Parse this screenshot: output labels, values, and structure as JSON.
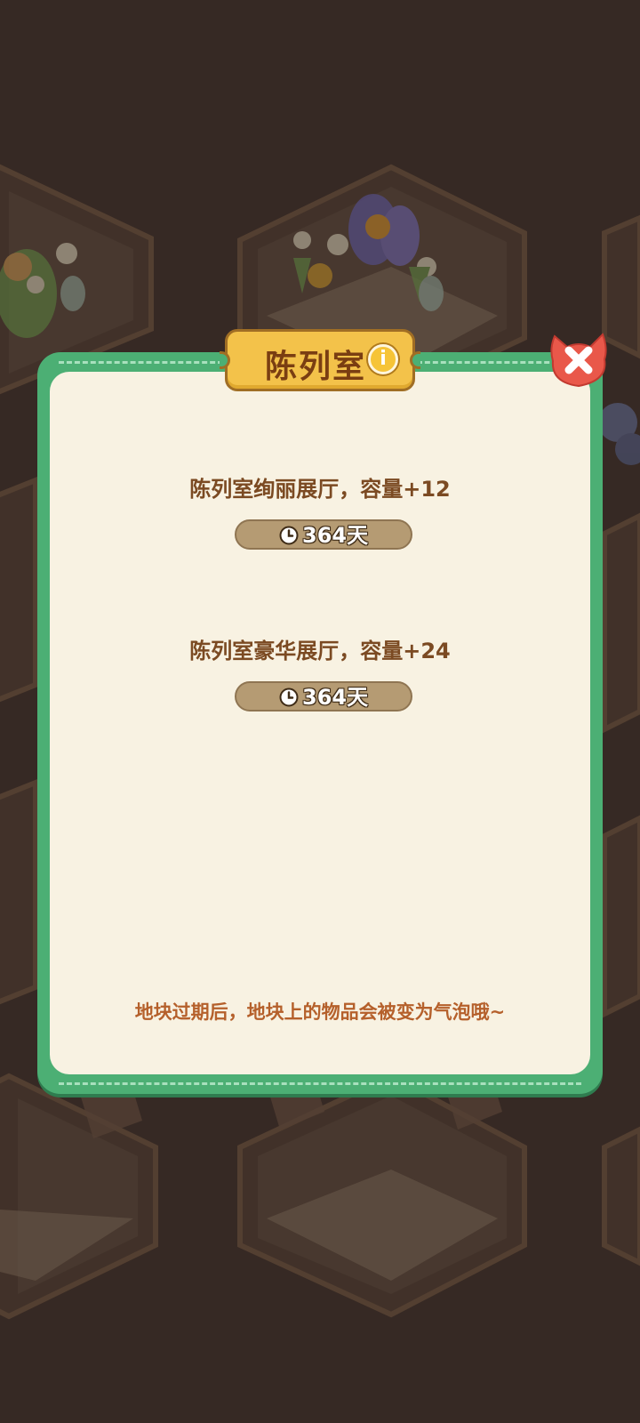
{
  "dialog": {
    "title": "陈列室",
    "info_icon": "info-icon",
    "close_icon": "close-icon",
    "items": [
      {
        "label": "陈列室绚丽展厅，容量+12",
        "duration": "364天",
        "icon": "clock-icon"
      },
      {
        "label": "陈列室豪华展厅，容量+24",
        "duration": "364天",
        "icon": "clock-icon"
      }
    ],
    "footer_note": "地块过期后，地块上的物品会被变为气泡哦~"
  },
  "colors": {
    "dialog_border": "#4caf74",
    "dialog_fill": "#f8f2e2",
    "title_tab": "#f3c24a",
    "title_text": "#7a3e12",
    "close_button": "#e9584a",
    "pill": "#b59b73",
    "footer_text": "#b5602b"
  }
}
